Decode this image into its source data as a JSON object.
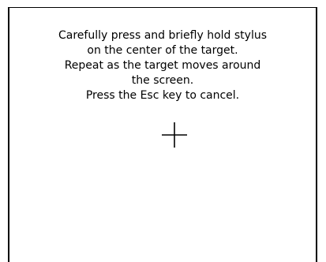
{
  "calibration": {
    "instructions": [
      "Carefully press and briefly hold stylus",
      "on the center of the target.",
      "Repeat as the target moves around",
      "the screen.",
      "Press the Esc key to cancel."
    ],
    "target_icon": "crosshair-target-icon"
  },
  "colors": {
    "background": "#ffffff",
    "text": "#000000",
    "frame": "#000000"
  }
}
